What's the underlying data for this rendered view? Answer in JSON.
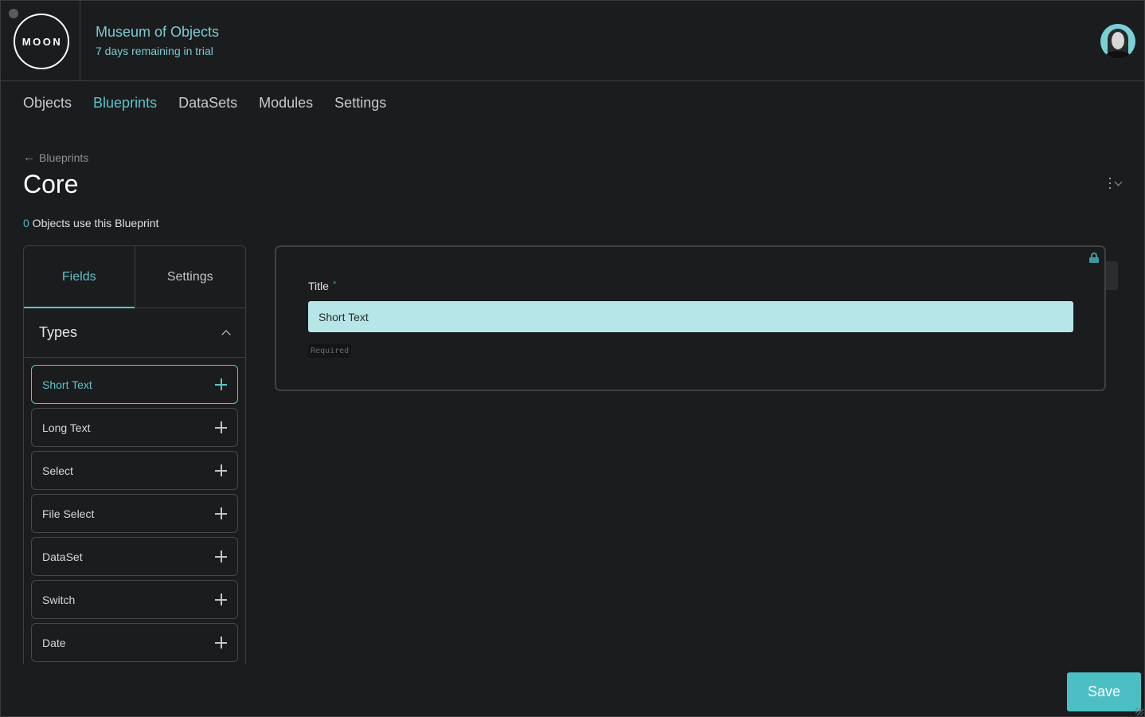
{
  "header": {
    "logo_text": "MOON",
    "org_name": "Museum of Objects",
    "trial_status": "7 days remaining in trial"
  },
  "nav": {
    "items": [
      {
        "label": "Objects",
        "active": false
      },
      {
        "label": "Blueprints",
        "active": true
      },
      {
        "label": "DataSets",
        "active": false
      },
      {
        "label": "Modules",
        "active": false
      },
      {
        "label": "Settings",
        "active": false
      }
    ]
  },
  "page": {
    "breadcrumb": "Blueprints",
    "title": "Core",
    "usage_count": "0",
    "usage_text": " Objects use this Blueprint"
  },
  "left_panel": {
    "tabs": [
      {
        "label": "Fields",
        "active": true
      },
      {
        "label": "Settings",
        "active": false
      }
    ],
    "section_title": "Types",
    "types": [
      {
        "label": "Short Text",
        "active": true
      },
      {
        "label": "Long Text",
        "active": false
      },
      {
        "label": "Select",
        "active": false
      },
      {
        "label": "File Select",
        "active": false
      },
      {
        "label": "DataSet",
        "active": false
      },
      {
        "label": "Switch",
        "active": false
      },
      {
        "label": "Date",
        "active": false
      }
    ]
  },
  "field_card": {
    "label": "Title",
    "required_marker": "*",
    "input_value": "Short Text",
    "badge": "Required"
  },
  "actions": {
    "save_label": "Save"
  },
  "colors": {
    "accent": "#5cc3c9",
    "save_button": "#4cbfc5",
    "input_fill": "#b7e6e8",
    "background": "#1b1c1e"
  }
}
